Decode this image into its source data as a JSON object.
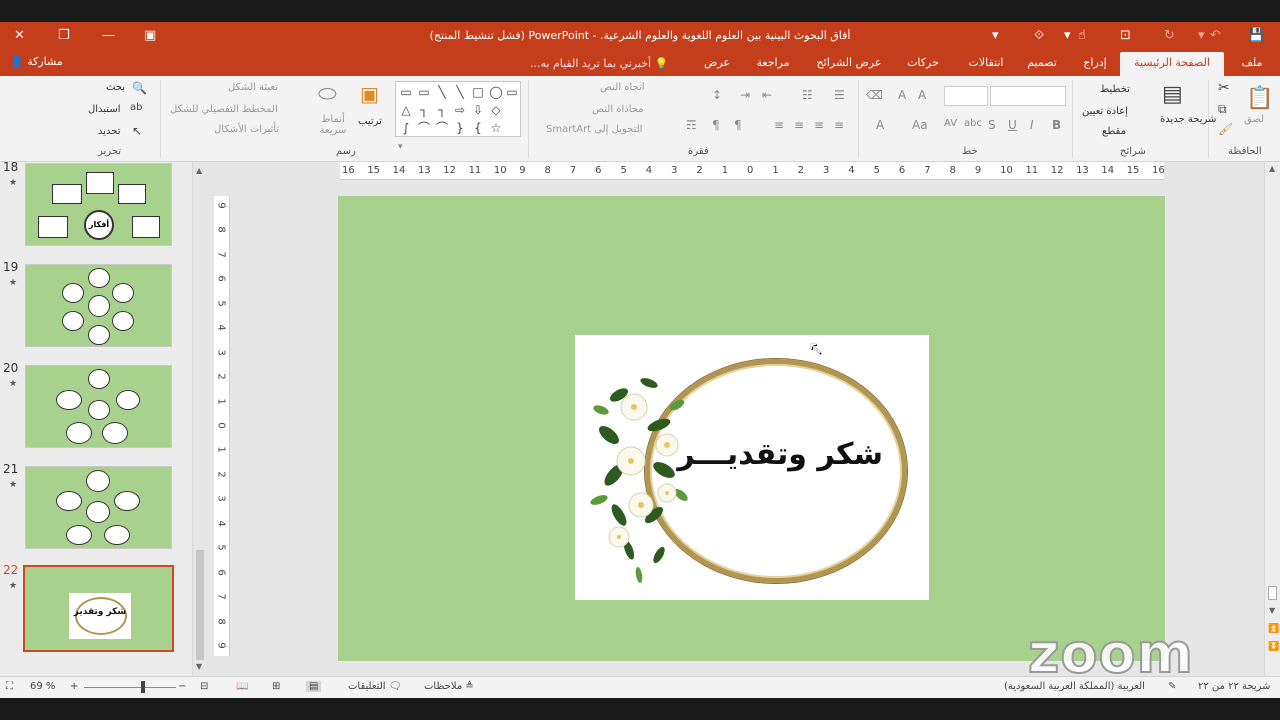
{
  "window": {
    "title": "أفاق البحوث البينية بين العلوم اللغوية والعلوم الشرعية. - PowerPoint (فشل تنشيط المنتج)",
    "share_label": "مشاركة",
    "tell_me": "أخبرني بما تريد القيام به..."
  },
  "tabs": [
    {
      "label": "ملف",
      "active": false
    },
    {
      "label": "الصفحة الرئيسية",
      "active": true
    },
    {
      "label": "إدراج",
      "active": false
    },
    {
      "label": "تصميم",
      "active": false
    },
    {
      "label": "انتقالات",
      "active": false
    },
    {
      "label": "حركات",
      "active": false
    },
    {
      "label": "عرض الشرائح",
      "active": false
    },
    {
      "label": "مراجعة",
      "active": false
    },
    {
      "label": "عرض",
      "active": false
    }
  ],
  "ribbon": {
    "clipboard": {
      "group": "الحافظة",
      "paste": "لصق"
    },
    "slides": {
      "group": "شرائح",
      "new_slide": "شريحة جديدة",
      "layout": "تخطيط",
      "reset": "إعادة تعيين",
      "section": "مقطع"
    },
    "font": {
      "group": "خط"
    },
    "paragraph": {
      "group": "فقرة",
      "text_direction": "اتجاه النص",
      "align_text": "محاذاة النص",
      "smartart": "التحويل إلى SmartArt"
    },
    "drawing": {
      "group": "رسم",
      "arrange": "ترتيب",
      "quick_styles": "أنماط سريعة",
      "shape_fill": "تعبئة الشكل",
      "shape_outline": "المخطط التفصيلي للشكل",
      "shape_effects": "تأثيرات الأشكال"
    },
    "editing": {
      "group": "تحرير",
      "find": "بحث",
      "replace": "استبدال",
      "select": "تحديد"
    }
  },
  "thumbnails": [
    {
      "number": "18",
      "star": "★"
    },
    {
      "number": "19",
      "star": "★"
    },
    {
      "number": "20",
      "star": "★"
    },
    {
      "number": "21",
      "star": "★"
    },
    {
      "number": "22",
      "star": "★",
      "selected": true
    }
  ],
  "thumb18_center": "أفكار",
  "thumb22_text": "شكر وتقدير",
  "ruler": {
    "horizontal": [
      "16",
      "15",
      "14",
      "13",
      "12",
      "11",
      "10",
      "9",
      "8",
      "7",
      "6",
      "5",
      "4",
      "3",
      "2",
      "1",
      "0",
      "1",
      "2",
      "3",
      "4",
      "5",
      "6",
      "7",
      "8",
      "9",
      "10",
      "11",
      "12",
      "13",
      "14",
      "15",
      "16"
    ],
    "vertical": [
      "9",
      "8",
      "7",
      "6",
      "5",
      "4",
      "3",
      "2",
      "1",
      "0",
      "1",
      "2",
      "3",
      "4",
      "5",
      "6",
      "7",
      "8",
      "9"
    ]
  },
  "slide": {
    "text": "شكر وتقديـــر",
    "background": "#a9d18e"
  },
  "watermark": "zoom",
  "status": {
    "slide_counter": "شريحة ٢٢ من ٢٢",
    "language": "العربية (المملكة العربية السعودية)",
    "notes": "ملاحظات",
    "comments": "التعليقات",
    "zoom": "69 %"
  },
  "colors": {
    "accent": "#c43e1c",
    "slide_bg": "#a9d18e",
    "selection": "#d24726"
  }
}
